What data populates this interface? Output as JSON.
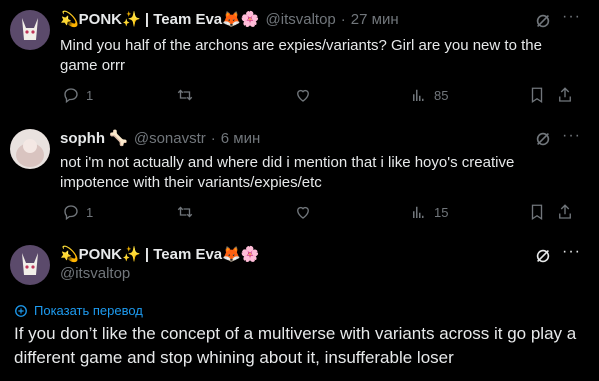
{
  "tweets": [
    {
      "name": "💫PONK✨ | Team Eva🦊🌸",
      "handle": "@itsvaltop",
      "time": "27 мин",
      "text": "Mind you half of the archons are expies/variants? Girl are you new to the game orrr",
      "replies": "1",
      "retweets": "",
      "likes": "",
      "views": "85"
    },
    {
      "name": "sophh 🦴",
      "handle": "@sonavstr",
      "time": "6 мин",
      "text": "not i'm not actually and where did i mention that i like hoyo's creative impotence with their variants/expies/etc",
      "replies": "1",
      "retweets": "",
      "likes": "",
      "views": "15"
    }
  ],
  "focused": {
    "name": "💫PONK✨ | Team Eva🦊🌸",
    "handle": "@itsvaltop",
    "translate_label": "Показать перевод",
    "text": "If you don’t like the concept of a multiverse with variants across it go play a different game and stop whining about it, insufferable loser"
  },
  "colors": {
    "accent": "#1d9bf0",
    "muted": "#71767b",
    "text": "#e7e9ea",
    "background": "#000000"
  },
  "icons": [
    "grok-icon",
    "more-icon",
    "reply-icon",
    "retweet-icon",
    "like-icon",
    "views-icon",
    "bookmark-icon",
    "share-icon",
    "translate-icon"
  ]
}
